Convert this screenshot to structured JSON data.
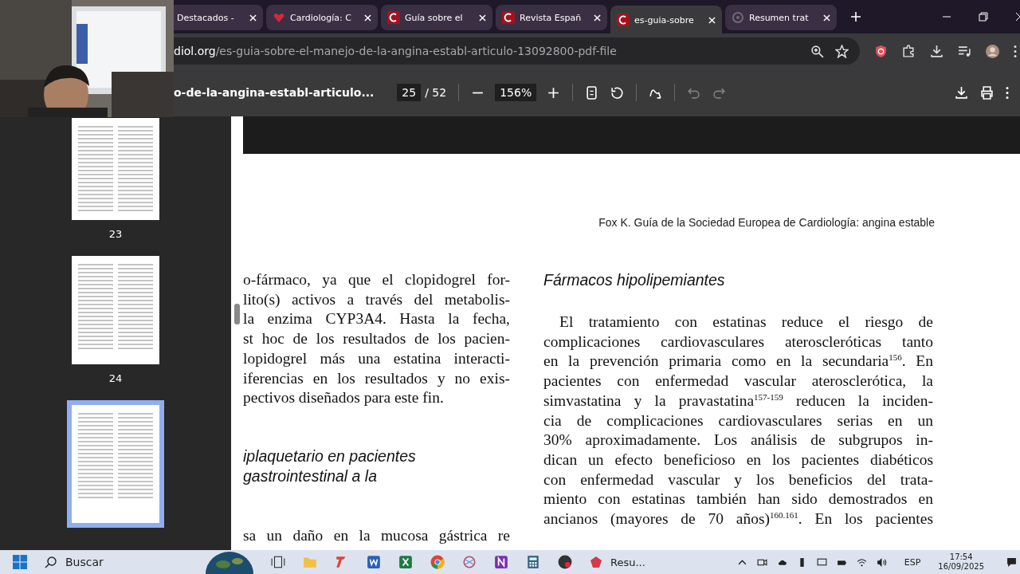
{
  "tabs": [
    {
      "label": "Destacados - ",
      "kind": "plain",
      "selected": false
    },
    {
      "label": "Cardiología: C",
      "kind": "heart",
      "selected": false
    },
    {
      "label": "Guía sobre el",
      "kind": "letter",
      "selected": false
    },
    {
      "label": "Revista Españ",
      "kind": "letter",
      "selected": false
    },
    {
      "label": "es-guia-sobre",
      "kind": "letter",
      "selected": true
    },
    {
      "label": "Resumen trat",
      "kind": "swirl",
      "selected": false
    }
  ],
  "address": {
    "domain": "diol.org",
    "path": "/es-guia-sobre-el-manejo-de-la-angina-establ-articulo-13092800-pdf-file"
  },
  "pdf_toolbar": {
    "title": "o-de-la-angina-establ-articulo...",
    "page": "25",
    "page_count": "/ 52",
    "zoom": "156%",
    "undo_disabled": true
  },
  "thumbnails": [
    {
      "label": "23",
      "selected": false
    },
    {
      "label": "24",
      "selected": false
    },
    {
      "selected": true
    }
  ],
  "page": {
    "running_head": "Fox K. Guía de la Sociedad Europea de Cardiología: angina estable",
    "left_lines": [
      "o-fármaco, ya que el clopidogrel for-",
      "lito(s) activos a través del metabolis-",
      "la enzima CYP3A4. Hasta la fecha,",
      "st hoc de los resultados de los pacien-",
      "lopidogrel más una estatina interacti-",
      "iferencias en los resultados y no exis-",
      "pectivos diseñados para este fin."
    ],
    "left_heading": [
      "iplaquetario en pacientes",
      "gastrointestinal a la"
    ],
    "left_tail": [
      "sa un daño en la mucosa gástrica re"
    ],
    "right_heading": "Fármacos hipolipemiantes",
    "right_lines": [
      "El tratamiento con estatinas reduce el riesgo de",
      "complicaciones cardiovasculares ateroscleróticas tanto",
      "en la prevención primaria como en la secundaria$^{156}$. En",
      "pacientes con enfermedad vascular aterosclerótica, la",
      "simvastatina y la pravastatina$^{157-159}$ reducen la inciden-",
      "cia de complicaciones cardiovasculares serias en un",
      "30% aproximadamente. Los análisis de subgrupos in-",
      "dican un efecto beneficioso en los pacientes diabéticos",
      "con enfermedad vascular y los beneficios del trata-",
      "miento con estatinas también han sido demostrados en",
      "ancianos (mayores de 70 años)$^{160.161}$. En los pacientes"
    ]
  },
  "taskbar": {
    "search": "Buscar",
    "app_label": "Resu...",
    "language": "ESP",
    "time": "17:54",
    "date": "16/09/2025"
  }
}
